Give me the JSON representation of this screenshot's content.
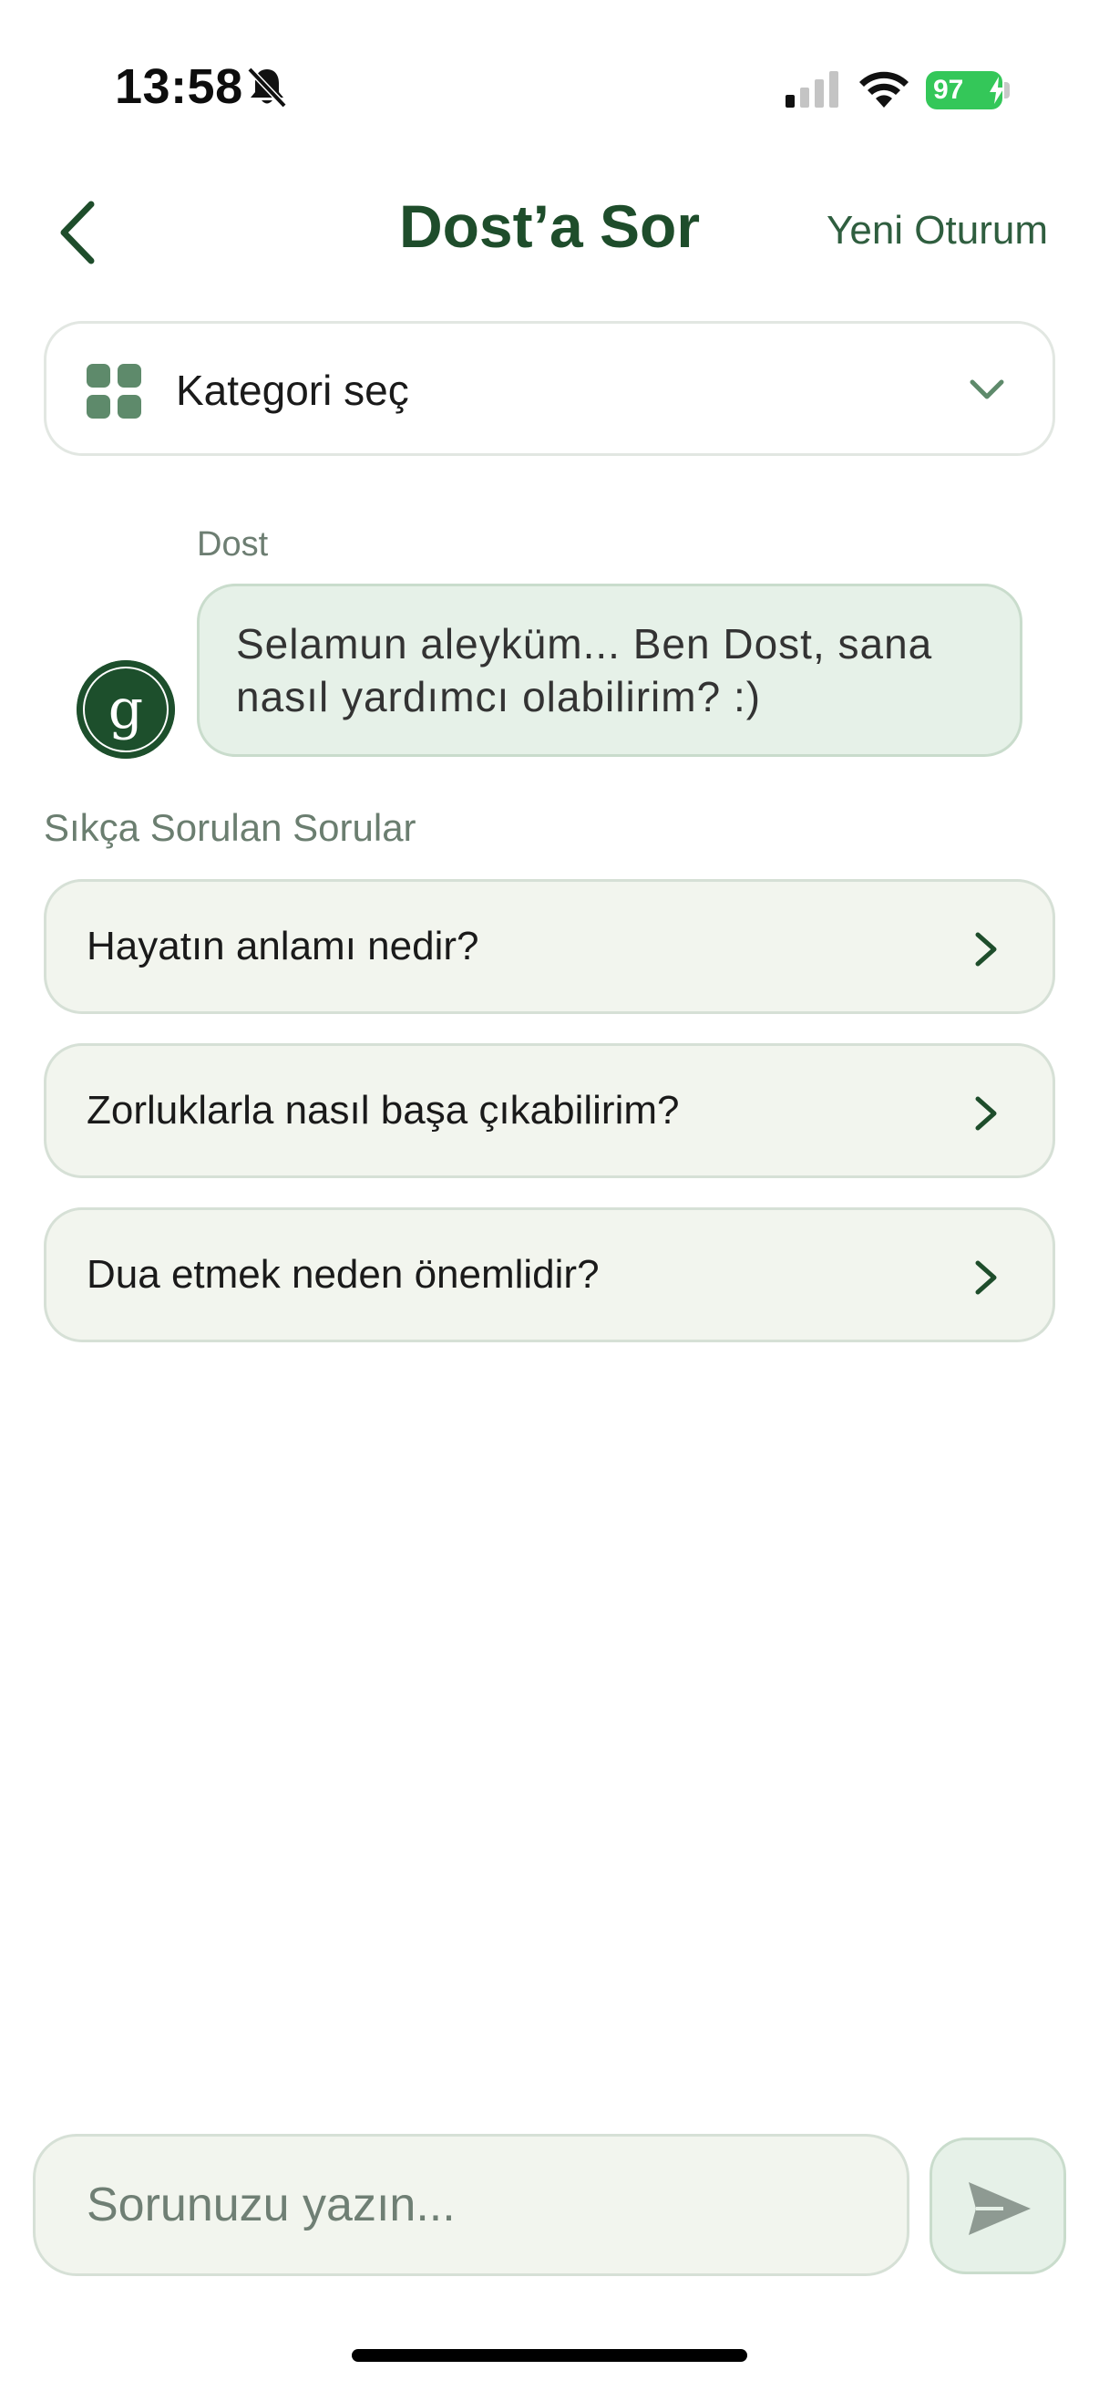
{
  "status_bar": {
    "time": "13:58",
    "battery": "97"
  },
  "header": {
    "title": "Dost’a Sor",
    "new_session_label": "Yeni Oturum"
  },
  "category": {
    "label": "Kategori seç"
  },
  "chat": {
    "sender_name": "Dost",
    "bot_message": "Selamun aleyküm... Ben Dost, sana nasıl yardımcı olabilirim? :)"
  },
  "faq": {
    "title": "Sıkça Sorulan Sorular",
    "items": [
      {
        "label": "Hayatın anlamı nedir?"
      },
      {
        "label": "Zorluklarla nasıl başa çıkabilirim?"
      },
      {
        "label": "Dua etmek neden önemlidir?"
      }
    ]
  },
  "input": {
    "placeholder": "Sorunuzu yazın..."
  },
  "colors": {
    "primary_green": "#1e4d2b",
    "bubble_bg": "#e6f1e8",
    "faq_bg": "#f2f5ee",
    "battery_green": "#34c759"
  }
}
